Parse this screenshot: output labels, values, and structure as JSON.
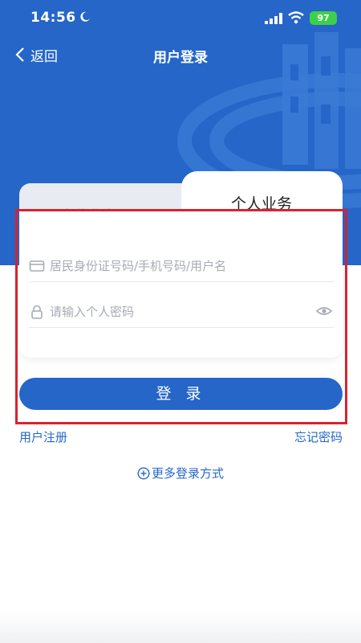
{
  "status_bar": {
    "time": "14:56",
    "battery": "97"
  },
  "nav": {
    "back_label": "返回",
    "title": "用户登录"
  },
  "tabs": [
    {
      "label": "企业业务",
      "active": false
    },
    {
      "label": "个人业务",
      "active": true
    }
  ],
  "form": {
    "username_placeholder": "居民身份证号码/手机号码/用户名",
    "username_value": "",
    "password_placeholder": "请输入个人密码",
    "password_value": ""
  },
  "login_button": "登 录",
  "links": {
    "register": "用户注册",
    "forgot": "忘记密码"
  },
  "more_login": "更多登录方式",
  "colors": {
    "brand": "#2566c8",
    "highlight": "#d6242f",
    "battery": "#3ecf4a"
  },
  "icons": [
    "moon-icon",
    "signal-icon",
    "wifi-icon",
    "back-icon",
    "id-card-icon",
    "lock-icon",
    "eye-icon",
    "plus-circle-icon"
  ]
}
